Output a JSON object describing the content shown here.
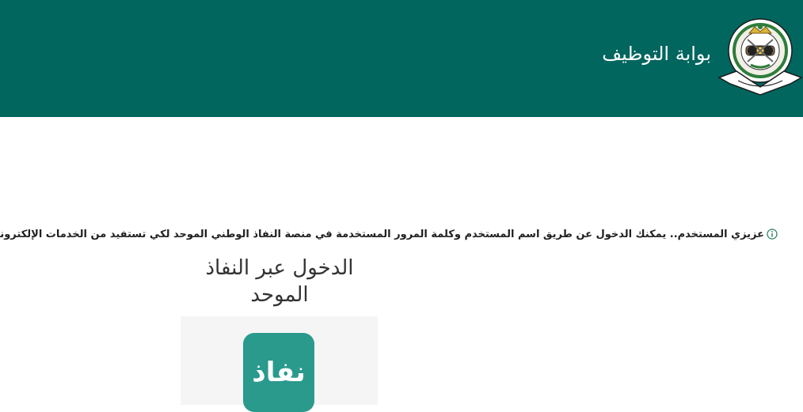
{
  "header": {
    "title": "بوابة التوظيف",
    "logo_icon": "national-guard-emblem-icon",
    "background_color": "#01665e"
  },
  "notice": {
    "icon": "info-circle-icon",
    "text": "عزيزي المستخدم.. يمكنك الدخول عن طريق اسم المستخدم وكلمة المرور المستخدمة في منصة النفاذ الوطني الموحد لكي تستفيد من الخدمات الإلكترونية"
  },
  "login_card": {
    "title_line1": "الدخول عبر النفاذ",
    "title_line2": "الموحد",
    "nafath_button_label": "نفاذ",
    "nafath_color": "#2a9a8d"
  }
}
